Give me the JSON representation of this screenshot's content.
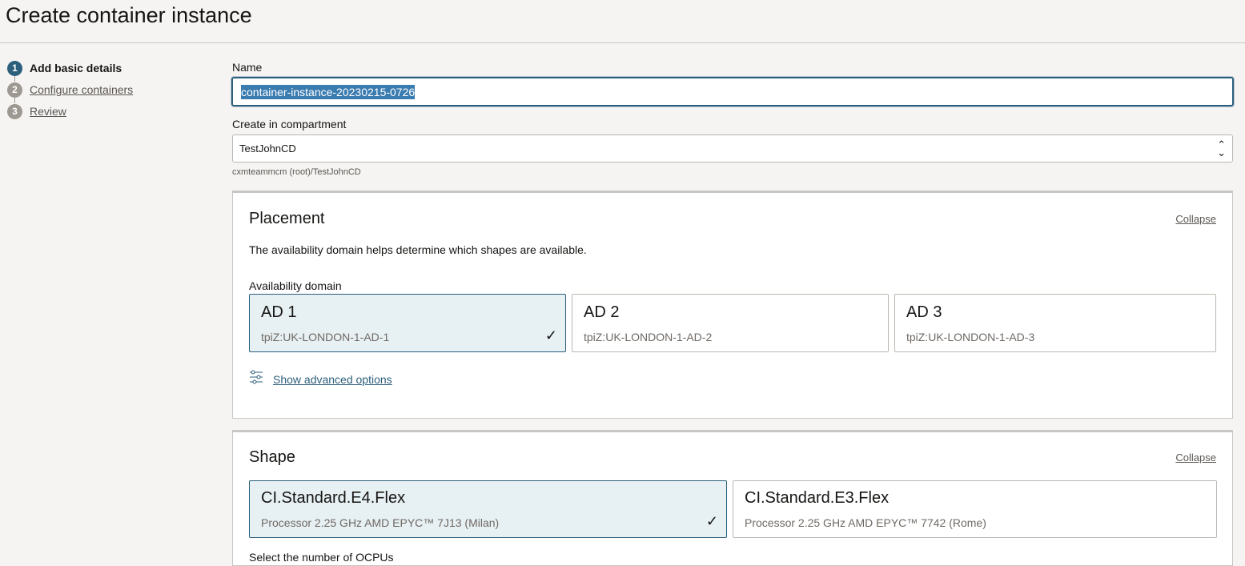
{
  "page": {
    "title": "Create container instance"
  },
  "steps": [
    {
      "number": "1",
      "label": "Add basic details",
      "active": true
    },
    {
      "number": "2",
      "label": "Configure containers",
      "active": false
    },
    {
      "number": "3",
      "label": "Review",
      "active": false
    }
  ],
  "name": {
    "label": "Name",
    "value": "container-instance-20230215-0726"
  },
  "compartment": {
    "label": "Create in compartment",
    "value": "TestJohnCD",
    "path": "cxmteammcm (root)/TestJohnCD"
  },
  "placement": {
    "title": "Placement",
    "collapse": "Collapse",
    "description": "The availability domain helps determine which shapes are available.",
    "ad_label": "Availability domain",
    "domains": [
      {
        "name": "AD 1",
        "sub": "tpiZ:UK-LONDON-1-AD-1",
        "selected": true
      },
      {
        "name": "AD 2",
        "sub": "tpiZ:UK-LONDON-1-AD-2",
        "selected": false
      },
      {
        "name": "AD 3",
        "sub": "tpiZ:UK-LONDON-1-AD-3",
        "selected": false
      }
    ],
    "advanced": "Show advanced options"
  },
  "shape": {
    "title": "Shape",
    "collapse": "Collapse",
    "shapes": [
      {
        "name": "CI.Standard.E4.Flex",
        "sub": "Processor 2.25 GHz AMD EPYC™ 7J13 (Milan)",
        "selected": true
      },
      {
        "name": "CI.Standard.E3.Flex",
        "sub": "Processor 2.25 GHz AMD EPYC™ 7742 (Rome)",
        "selected": false
      }
    ],
    "ocpu_label": "Select the number of OCPUs"
  },
  "icons": {
    "check": "check-icon",
    "options": "sliders-icon",
    "chevron": "chevron-updown-icon"
  },
  "colors": {
    "accent": "#2c5f7c",
    "selected_bg": "#e7f0f3",
    "page_bg": "#f5f4f2"
  }
}
